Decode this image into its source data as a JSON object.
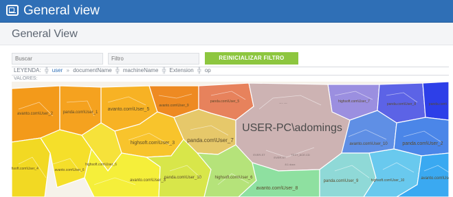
{
  "header": {
    "title": "General view",
    "icon": "dashboard-icon"
  },
  "page": {
    "title": "General View"
  },
  "controls": {
    "search_placeholder": "Buscar",
    "filter_placeholder": "Filtro",
    "reset_label": "REINICIALIZAR FILTRO"
  },
  "legend": {
    "label": "LEYENDA:",
    "items": [
      "user",
      "documentName",
      "machineName",
      "Extension",
      "op"
    ],
    "values_label": "VALORES:"
  },
  "voronoi": {
    "cells": [
      {
        "label": "avanto.com\\User_2",
        "color": "#f39a1a"
      },
      {
        "label": "panda.com\\User_1",
        "color": "#f5a21f"
      },
      {
        "label": "avanto.com\\User_5",
        "color": "#f7b224"
      },
      {
        "label": "avanto.com\\User_9",
        "color": "#ee8a22"
      },
      {
        "label": "panda.com\\User_5",
        "color": "#e7825c"
      },
      {
        "label": "highsoft.com\\User_7",
        "color": "#9b8fe0"
      },
      {
        "label": "panda.com\\User_8",
        "color": "#5c63e6"
      },
      {
        "label": "panda.com\\",
        "color": "#2d3fe8"
      },
      {
        "label": "highsoft.com\\User_3",
        "color": "#f8c42c"
      },
      {
        "label": "panda.com\\User_7",
        "color": "#e6c86a"
      },
      {
        "label": "USER-PC\\adomings",
        "color": "#cdb3b3"
      },
      {
        "label": "avanto.com\\User_10",
        "color": "#5f8fe5"
      },
      {
        "label": "panda.com\\User_2",
        "color": "#4b86e8"
      },
      {
        "label": "highsoft.com\\User_4",
        "color": "#f2d923"
      },
      {
        "label": "avanto.com\\User_6",
        "color": "#f5df2a"
      },
      {
        "label": "highsoft.com\\User_6",
        "color": "#f6e23a"
      },
      {
        "label": "avanto.com\\User_3",
        "color": "#f5ef3a"
      },
      {
        "label": "panda.com\\User_10",
        "color": "#d8e64a"
      },
      {
        "label": "highsoft.com\\User_6",
        "color": "#b5e37a"
      },
      {
        "label": "avanto.com\\User_8",
        "color": "#8ee0a0"
      },
      {
        "label": "panda.com\\User_9",
        "color": "#8fd9d7"
      },
      {
        "label": "highsoft.com\\User_10",
        "color": "#69c9ee"
      },
      {
        "label": "avanto.com\\User",
        "color": "#3aa9f1"
      }
    ],
    "details": [
      "... ...",
      "EVER-ST",
      "EVER-ST",
      "TEST_ACE.CD",
      "8.1 docx"
    ]
  }
}
